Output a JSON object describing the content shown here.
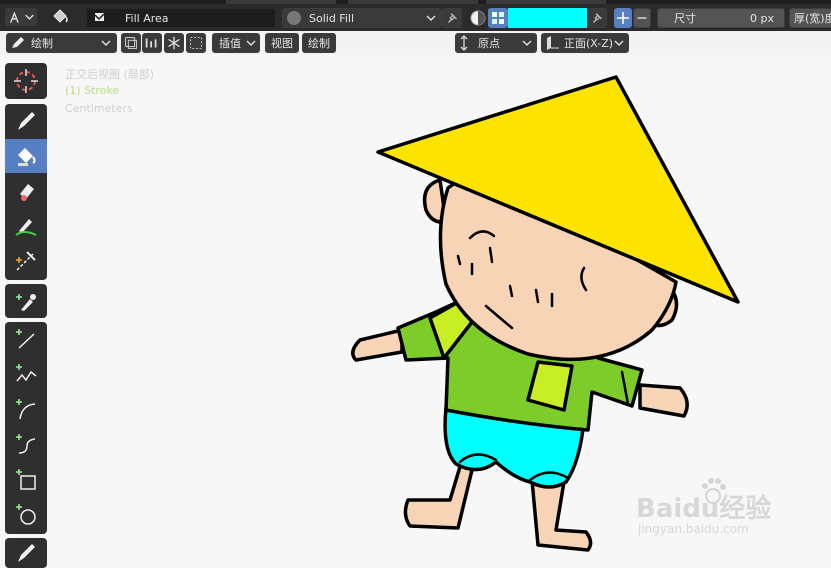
{
  "tool_header": {
    "material_name": "Fill Area",
    "fill_style": "Solid Fill",
    "fill_color": "#00ffff",
    "size_label": "尺寸",
    "size_value": "0 px",
    "thickness_label": "厚(宽)度"
  },
  "header": {
    "mode": "绘制",
    "interpolate_label": "插值",
    "view_menu": "视图",
    "draw_menu": "绘制",
    "origin_label": "原点",
    "orientation_label": "正面(X-Z)"
  },
  "toolbar": {
    "active_tool": "fill-tool",
    "active_color": "#5680c2"
  },
  "viewport": {
    "view_name": "正交后视图 (局部)",
    "object_name": "(1) Stroke",
    "units": "Centimeters"
  },
  "colors": {
    "hat": "#fce400",
    "skin": "#f8d4b6",
    "shirt": "#7dcc2a",
    "collar": "#c8ef26",
    "shorts": "#00ffff",
    "outline": "#000000"
  },
  "watermark": {
    "brand": "Baidu经验",
    "url": "jingyan.baidu.com"
  }
}
